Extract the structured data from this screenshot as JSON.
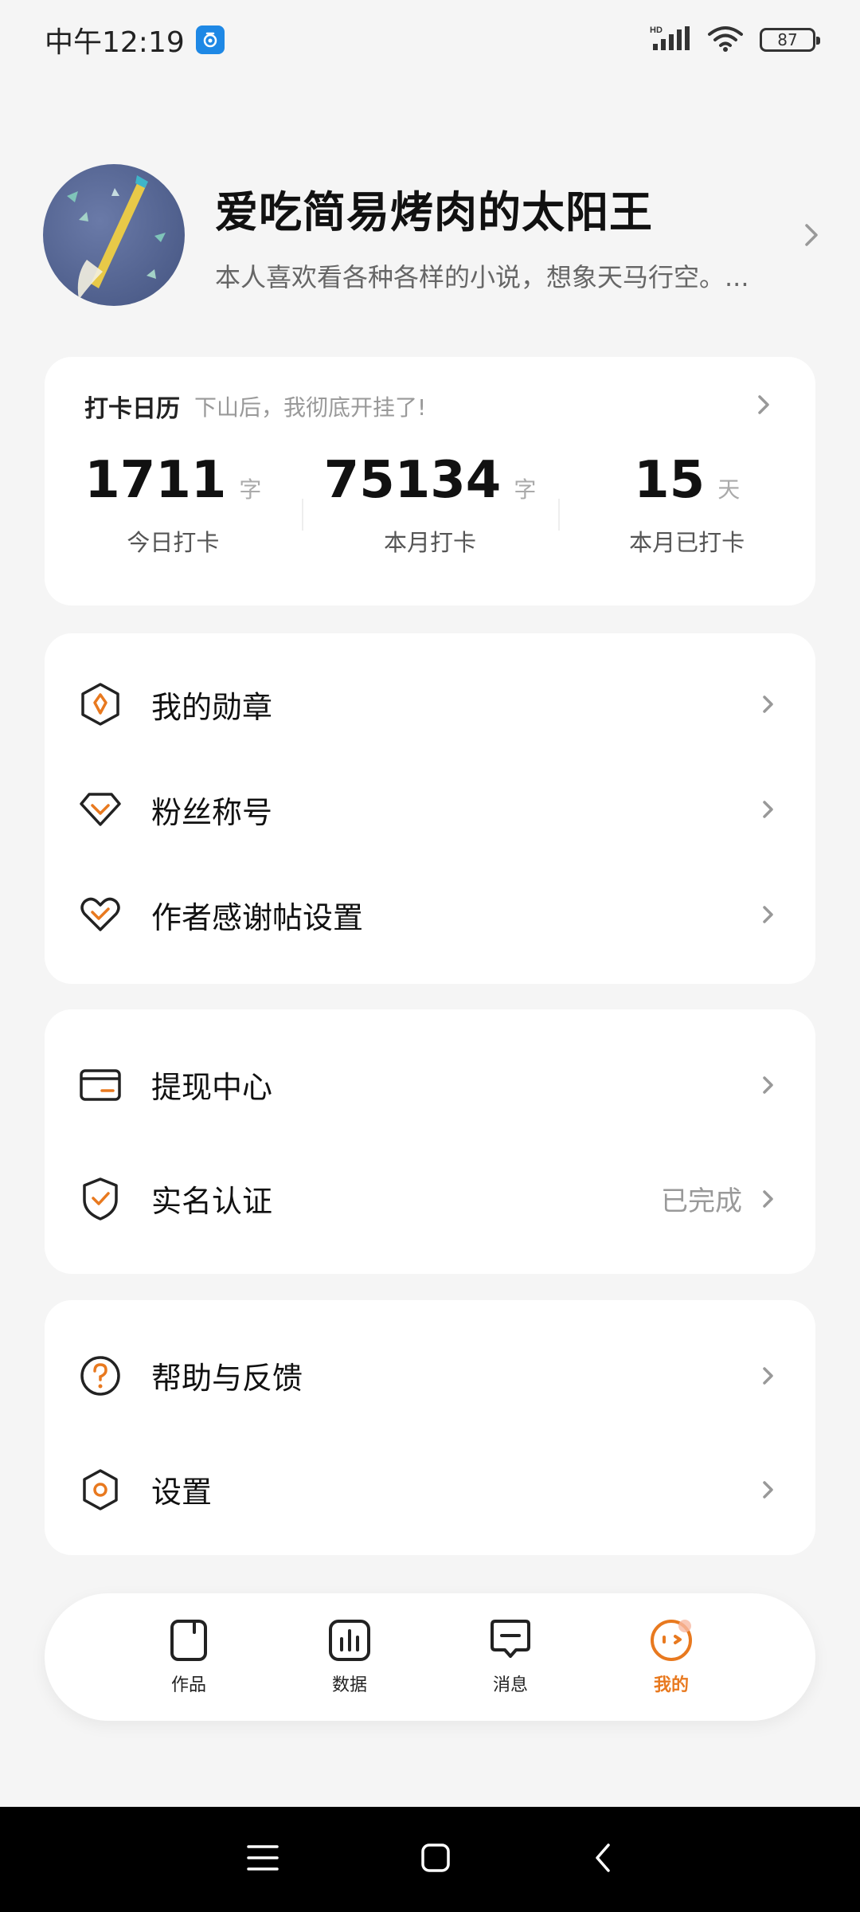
{
  "status_bar": {
    "time": "中午12:19",
    "battery": "87",
    "network_label": "HD"
  },
  "profile": {
    "name": "爱吃简易烤肉的太阳王",
    "bio": "本人喜欢看各种各样的小说，想象天马行空。..."
  },
  "checkin": {
    "title": "打卡日历",
    "subtitle": "下山后，我彻底开挂了!",
    "stats": [
      {
        "value": "1711",
        "unit": "字",
        "label": "今日打卡"
      },
      {
        "value": "75134",
        "unit": "字",
        "label": "本月打卡"
      },
      {
        "value": "15",
        "unit": "天",
        "label": "本月已打卡"
      }
    ]
  },
  "menu_group1": [
    {
      "label": "我的勋章",
      "icon": "medal-icon"
    },
    {
      "label": "粉丝称号",
      "icon": "diamond-icon"
    },
    {
      "label": "作者感谢帖设置",
      "icon": "heart-icon"
    }
  ],
  "menu_group2": [
    {
      "label": "提现中心",
      "icon": "wallet-icon",
      "value": ""
    },
    {
      "label": "实名认证",
      "icon": "shield-check-icon",
      "value": "已完成"
    }
  ],
  "menu_group3": [
    {
      "label": "帮助与反馈",
      "icon": "help-icon"
    },
    {
      "label": "设置",
      "icon": "settings-icon"
    }
  ],
  "bottom_nav": [
    {
      "label": "作品",
      "icon": "works-icon",
      "active": false
    },
    {
      "label": "数据",
      "icon": "data-chart-icon",
      "active": false
    },
    {
      "label": "消息",
      "icon": "message-icon",
      "active": false
    },
    {
      "label": "我的",
      "icon": "me-icon",
      "active": true
    }
  ],
  "colors": {
    "accent": "#e8791f",
    "background": "#f5f5f5",
    "card": "#ffffff",
    "avatar_bg": "#5a6a98"
  }
}
